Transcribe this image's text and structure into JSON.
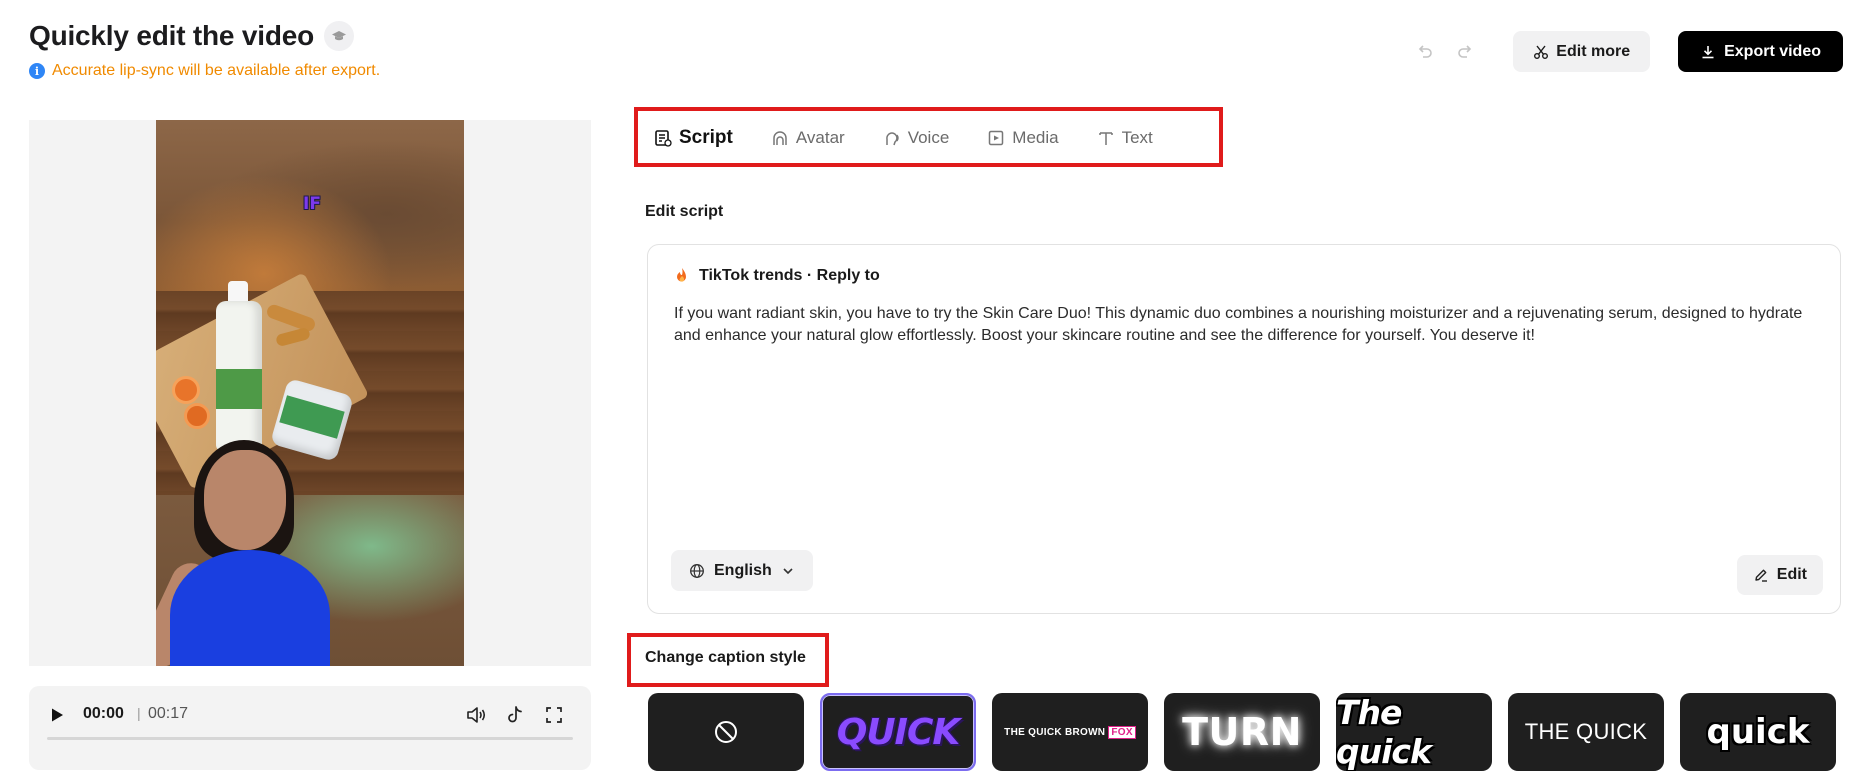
{
  "header": {
    "title": "Quickly edit the video",
    "notice": "Accurate lip-sync will be available after export.",
    "info_icon": "i"
  },
  "toolbar": {
    "undo_icon": "undo-icon",
    "redo_icon": "redo-icon",
    "edit_more_label": "Edit more",
    "export_label": "Export video"
  },
  "preview": {
    "overlay_text": "IF"
  },
  "player": {
    "current_time": "00:00",
    "separator": "|",
    "total_time": "00:17",
    "progress": 0.0
  },
  "tabs": [
    {
      "label": "Script",
      "icon": "script-icon",
      "active": true
    },
    {
      "label": "Avatar",
      "icon": "avatar-icon",
      "active": false
    },
    {
      "label": "Voice",
      "icon": "voice-icon",
      "active": false
    },
    {
      "label": "Media",
      "icon": "media-icon",
      "active": false
    },
    {
      "label": "Text",
      "icon": "text-icon",
      "active": false
    }
  ],
  "script": {
    "section_label": "Edit script",
    "source": "TikTok trends · Reply to",
    "body": "If you want radiant skin, you have to try the Skin Care Duo! This dynamic duo combines a nourishing moisturizer and a rejuvenating serum, designed to hydrate and enhance your natural glow effortlessly. Boost your skincare routine and see the difference for yourself. You deserve it!",
    "language": "English",
    "edit_label": "Edit"
  },
  "captions": {
    "section_label": "Change caption style",
    "styles": [
      {
        "id": "none",
        "preview": ""
      },
      {
        "id": "purple-bold",
        "preview": "QUICK",
        "selected": true
      },
      {
        "id": "fox",
        "preview": "THE QUICK BROWN",
        "highlight": "FOX"
      },
      {
        "id": "glow",
        "preview": "TURN"
      },
      {
        "id": "italic-outline",
        "preview": "The quick"
      },
      {
        "id": "plain",
        "preview": "THE QUICK"
      },
      {
        "id": "lower-outline",
        "preview": "quick"
      }
    ]
  },
  "colors": {
    "accent_red": "#e01b1b",
    "notice_orange": "#f08a00",
    "selected_outline": "#7c6cf0",
    "export_bg": "#000000"
  }
}
